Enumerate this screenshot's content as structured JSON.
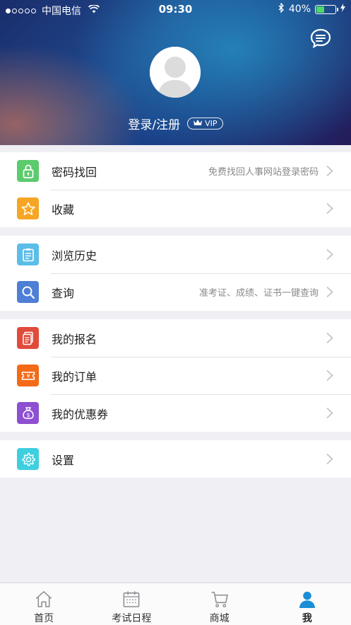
{
  "status_bar": {
    "carrier": "中国电信",
    "time": "09:30",
    "battery": "40%",
    "battery_level": 0.4
  },
  "profile": {
    "login_label": "登录/注册",
    "vip_label": "VIP"
  },
  "menu_groups": [
    [
      {
        "label": "密码找回",
        "hint": "免费找回人事网站登录密码",
        "icon": "lock-icon",
        "color": "#5ccb6d"
      },
      {
        "label": "收藏",
        "hint": "",
        "icon": "star-icon",
        "color": "#f6a623"
      }
    ],
    [
      {
        "label": "浏览历史",
        "hint": "",
        "icon": "clipboard-icon",
        "color": "#5bbde8"
      },
      {
        "label": "查询",
        "hint": "准考证、成绩、证书一键查询",
        "icon": "search-icon",
        "color": "#4e7fd6"
      }
    ],
    [
      {
        "label": "我的报名",
        "hint": "",
        "icon": "document-icon",
        "color": "#e04b3b"
      },
      {
        "label": "我的订单",
        "hint": "",
        "icon": "ticket-icon",
        "color": "#f36a18"
      },
      {
        "label": "我的优惠券",
        "hint": "",
        "icon": "money-bag-icon",
        "color": "#8e4fd0"
      }
    ],
    [
      {
        "label": "设置",
        "hint": "",
        "icon": "gear-icon",
        "color": "#3ecfdf"
      }
    ]
  ],
  "tabs": [
    {
      "label": "首页",
      "icon": "home-icon",
      "active": false
    },
    {
      "label": "考试日程",
      "icon": "calendar-icon",
      "active": false
    },
    {
      "label": "商城",
      "icon": "cart-icon",
      "active": false
    },
    {
      "label": "我",
      "icon": "person-icon",
      "active": true
    }
  ],
  "colors": {
    "active_tab": "#1a8fd6",
    "inactive_tab": "#8e8e93"
  }
}
